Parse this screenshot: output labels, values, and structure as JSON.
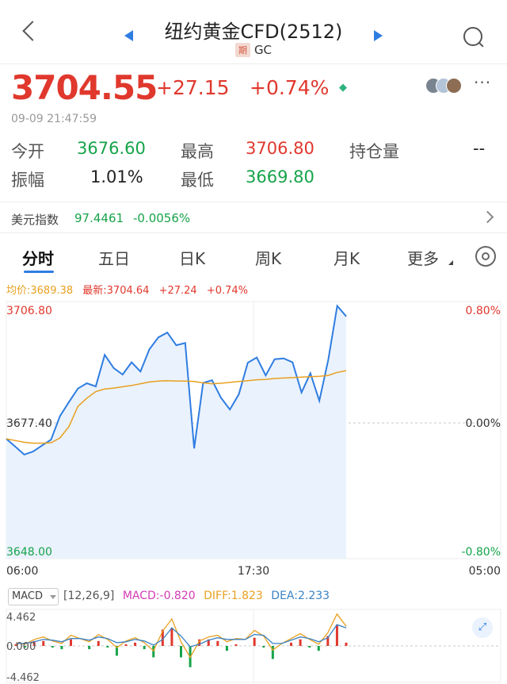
{
  "header": {
    "title": "纽约黄金CFD(2512)",
    "sub_badge": "期",
    "sub_code": "GC"
  },
  "quote": {
    "price": "3704.55",
    "change": "+27.15",
    "change_pct": "+0.74%",
    "timestamp": "09-09 21:47:59"
  },
  "stats": {
    "open_label": "今开",
    "open": "3676.60",
    "high_label": "最高",
    "high": "3706.80",
    "oi_label": "持仓量",
    "oi": "--",
    "amp_label": "振幅",
    "amp": "1.01%",
    "low_label": "最低",
    "low": "3669.80"
  },
  "index": {
    "label": "美元指数",
    "value": "97.4461",
    "change": "-0.0056%"
  },
  "tabs": [
    "分时",
    "五日",
    "日K",
    "周K",
    "月K",
    "更多"
  ],
  "intraday": {
    "avg_label": "均价:3689.38",
    "latest_label": "最新:3704.64",
    "latest_change": "+27.24",
    "latest_pct": "+0.74%"
  },
  "chart_data": [
    {
      "type": "line",
      "x_ticks": [
        "06:00",
        "17:30",
        "05:00"
      ],
      "y_left": [
        "3706.80",
        "3677.40",
        "3648.00"
      ],
      "y_right": [
        "0.80%",
        "0.00%",
        "-0.80%"
      ],
      "ylim": [
        3648.0,
        3706.8
      ],
      "series": [
        {
          "name": "最新",
          "values": [
            3675.4,
            3673.6,
            3671.8,
            3672.5,
            3673.9,
            3675.2,
            3680.6,
            3683.8,
            3686.9,
            3688.1,
            3687.4,
            3694.6,
            3691.6,
            3690.1,
            3692.9,
            3690.8,
            3695.9,
            3698.6,
            3699.7,
            3696.8,
            3697.3,
            3673.2,
            3688.2,
            3688.8,
            3684.8,
            3682.1,
            3685.6,
            3692.8,
            3694.0,
            3689.9,
            3693.6,
            3693.8,
            3692.9,
            3686.0,
            3690.4,
            3684.1,
            3693.5,
            3705.8,
            3703.4
          ]
        },
        {
          "name": "均价",
          "values": [
            3675.4,
            3675.0,
            3674.6,
            3674.4,
            3674.4,
            3674.5,
            3675.6,
            3678.2,
            3682.8,
            3684.7,
            3686.2,
            3686.8,
            3687.0,
            3687.3,
            3687.6,
            3688.0,
            3688.4,
            3688.6,
            3688.7,
            3688.6,
            3688.6,
            3688.5,
            3688.2,
            3688.0,
            3688.1,
            3688.3,
            3688.5,
            3688.7,
            3688.9,
            3689.0,
            3689.2,
            3689.3,
            3689.4,
            3689.5,
            3689.6,
            3689.7,
            3689.9,
            3690.6,
            3691.0
          ]
        }
      ]
    },
    {
      "type": "bar",
      "title": "MACD",
      "params": "[12,26,9]",
      "macd_label": "MACD:-0.820",
      "diff_label": "DIFF:1.823",
      "dea_label": "DEA:2.233",
      "y_ticks": [
        "4.462",
        "0.000",
        "-4.462"
      ],
      "ylim": [
        -4.462,
        4.462
      ],
      "series": [
        {
          "name": "DIFF",
          "values": [
            0.4,
            0.2,
            0.8,
            1.1,
            0.6,
            0.3,
            1.3,
            0.9,
            0.5,
            1.4,
            0.8,
            -0.2,
            0.6,
            1.0,
            0.4,
            -0.6,
            1.8,
            3.3,
            0.5,
            -1.4,
            0.6,
            1.1,
            1.3,
            0.5,
            0.9,
            0.8,
            1.9,
            1.2,
            -0.5,
            0.3,
            0.9,
            1.5,
            0.8,
            0.2,
            1.6,
            3.9,
            2.4
          ]
        },
        {
          "name": "DEA",
          "values": [
            0.3,
            0.3,
            0.5,
            0.8,
            0.7,
            0.5,
            0.9,
            0.9,
            0.7,
            1.1,
            0.9,
            0.4,
            0.5,
            0.8,
            0.6,
            0.1,
            0.8,
            2.2,
            1.2,
            -0.1,
            0.2,
            0.7,
            1.0,
            0.8,
            0.8,
            0.8,
            1.4,
            1.3,
            0.3,
            0.3,
            0.7,
            1.1,
            0.9,
            0.5,
            1.0,
            2.6,
            2.2
          ]
        },
        {
          "name": "MACD",
          "values": [
            0.2,
            -0.2,
            0.6,
            0.6,
            -0.2,
            -0.4,
            0.8,
            0.0,
            -0.4,
            0.6,
            -0.2,
            -1.2,
            0.2,
            0.4,
            -0.4,
            -1.4,
            2.0,
            2.2,
            -1.4,
            -2.6,
            0.8,
            0.8,
            0.6,
            -0.6,
            0.2,
            0.0,
            1.0,
            -0.2,
            -1.6,
            0.0,
            0.4,
            0.8,
            -0.2,
            -0.6,
            1.2,
            2.6,
            0.4
          ]
        }
      ]
    }
  ],
  "colors": {
    "up": "#e0382d",
    "down": "#16a34a",
    "accent": "#2f7de1",
    "avg_line": "#e8a020"
  },
  "icons": [
    "back-icon",
    "prev-contract-icon",
    "next-contract-icon",
    "search-icon",
    "more-icon",
    "settings-icon",
    "expand-icon"
  ]
}
